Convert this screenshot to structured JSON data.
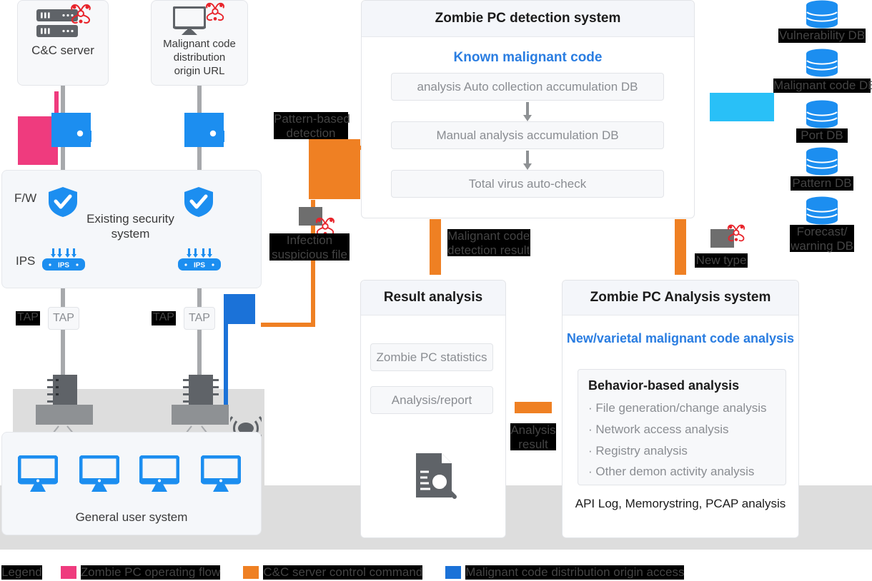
{
  "sources": [
    {
      "id": "cc-server",
      "label": "C&C server",
      "icon": "server-icon",
      "badge": "biohazard-icon"
    },
    {
      "id": "distribution-url",
      "label": "Malignant code\ndistribution\norigin URL",
      "icon": "monitor-icon",
      "badge": "biohazard-icon"
    }
  ],
  "existing_security": {
    "title": "Existing security\nsystem",
    "rows": [
      {
        "label": "F/W",
        "icon": "shield-check-icon"
      },
      {
        "label": "IPS",
        "icon": "ips-device-icon"
      }
    ]
  },
  "tap": {
    "label": "TAP",
    "count": 2
  },
  "general_user": {
    "title": "General user system",
    "pc_count": 4,
    "pc_icon": "monitor-icon",
    "ap_icon": "wireless-ap-icon"
  },
  "flow_labels": {
    "pattern_based": "Pattern-based\ndetection",
    "infection_suspicious": "Infection\nsuspicious file",
    "malignant_detection_result": "Malignant code\ndetection result",
    "new_type": "New type",
    "analysis_result": "Analysis\nresult"
  },
  "detection_system": {
    "title": "Zombie PC detection system",
    "subtitle": "Known malignant code",
    "steps": [
      "analysis Auto collection accumulation DB",
      "Manual analysis accumulation DB",
      "Total virus auto-check"
    ]
  },
  "result_analysis": {
    "title": "Result analysis",
    "items": [
      "Zombie PC statistics",
      "Analysis/report"
    ],
    "icon": "document-search-icon"
  },
  "analysis_system": {
    "title": "Zombie PC Analysis system",
    "subtitle": "New/varietal malignant code analysis",
    "box_title": "Behavior-based analysis",
    "box_items": [
      "· File generation/change analysis",
      "· Network access analysis",
      "· Registry analysis",
      "· Other demon activity analysis"
    ],
    "footer": "API Log, Memorystring, PCAP analysis"
  },
  "databases": [
    {
      "label": "Vulnerability DB",
      "icon": "database-icon"
    },
    {
      "label": "Malignant code DB",
      "icon": "database-icon"
    },
    {
      "label": "Port DB",
      "icon": "database-icon"
    },
    {
      "label": "Pattern DB",
      "icon": "database-icon"
    },
    {
      "label": "Forecast/\nwarning DB",
      "icon": "database-icon"
    }
  ],
  "legend": {
    "title": "Legend",
    "items": [
      {
        "label": "Zombie PC operating flow",
        "color": "#ef3b7e"
      },
      {
        "label": "C&C server control command",
        "color": "#ef8023"
      },
      {
        "label": "Malignant code distribution origin access",
        "color": "#1b72d8"
      }
    ]
  },
  "colors": {
    "pink": "#ef3b7e",
    "orange": "#ef8023",
    "blue": "#1b72d8",
    "light_blue": "#1c8ef0",
    "cyan": "#29c0f7",
    "grey_line": "#a7a9ac",
    "panel_head": "#f4f6fa",
    "band": "#dddddd",
    "accent_text": "#2a7de1"
  }
}
